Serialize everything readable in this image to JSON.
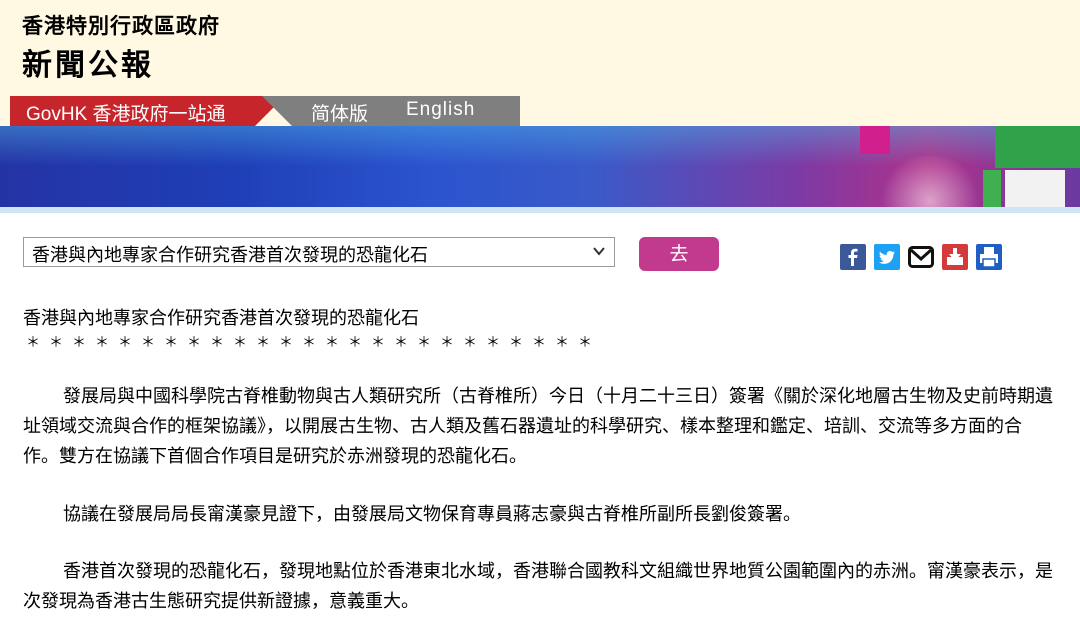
{
  "header": {
    "site_name": "香港特別行政區政府",
    "site_sub": "新聞公報"
  },
  "nav": {
    "govhk": "GovHK 香港政府一站通",
    "simplified": "简体版",
    "english": "English"
  },
  "selector": {
    "selected": "香港與內地專家合作研究香港首次發現的恐龍化石",
    "go_label": "去"
  },
  "share_icons": [
    "facebook-icon",
    "twitter-icon",
    "email-icon",
    "download-icon",
    "print-icon"
  ],
  "colors": {
    "facebook": "#3b5998",
    "twitter": "#1da1f2",
    "print": "#1f5fc3",
    "download": "#d43a3a",
    "go_button": "#c13a8d",
    "nav_red": "#c6262b"
  },
  "article": {
    "title": "香港與內地專家合作研究香港首次發現的恐龍化石",
    "stars": "＊＊＊＊＊＊＊＊＊＊＊＊＊＊＊＊＊＊＊＊＊＊＊＊＊",
    "paragraphs": [
      "發展局與中國科學院古脊椎動物與古人類研究所（古脊椎所）今日（十月二十三日）簽署《關於深化地層古生物及史前時期遺址領域交流與合作的框架協議》，以開展古生物、古人類及舊石器遺址的科學研究、樣本整理和鑑定、培訓、交流等多方面的合作。雙方在協議下首個合作項目是研究於赤洲發現的恐龍化石。",
      "協議在發展局局長甯漢豪見證下，由發展局文物保育專員蔣志豪與古脊椎所副所長劉俊簽署。",
      "香港首次發現的恐龍化石，發現地點位於香港東北水域，香港聯合國教科文組織世界地質公園範圍內的赤洲。甯漢豪表示，是次發現為香港古生態研究提供新證據，意義重大。"
    ]
  }
}
